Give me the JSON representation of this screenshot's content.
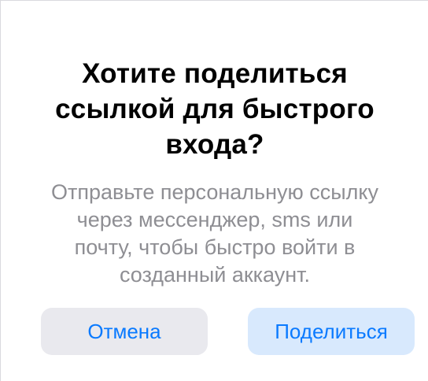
{
  "dialog": {
    "title": "Хотите поделиться\nссылкой для быстрого\nвхода?",
    "message": "Отправьте персональную ссылку\nчерез мессенджер, sms или\nпочту, чтобы быстро войти в\nсозданный аккаунт.",
    "cancel_label": "Отмена",
    "share_label": "Поделиться"
  },
  "colors": {
    "accent": "#0a7aff",
    "cancel_bg": "#e9e9ee",
    "share_bg": "#d8e9fd",
    "message_text": "#8e8e93"
  }
}
